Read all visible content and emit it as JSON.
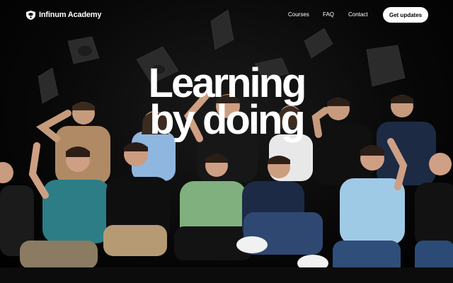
{
  "header": {
    "brand": "Infinum Academy",
    "nav": {
      "courses": "Courses",
      "faq": "FAQ",
      "contact": "Contact"
    },
    "cta_label": "Get updates"
  },
  "hero": {
    "line1": "Learning",
    "line2": "by doing"
  },
  "colors": {
    "background": "#050505",
    "text": "#ffffff",
    "cta_background": "#ffffff",
    "cta_text": "#000000"
  },
  "icons": {
    "logo": "infinum-logo-icon"
  }
}
